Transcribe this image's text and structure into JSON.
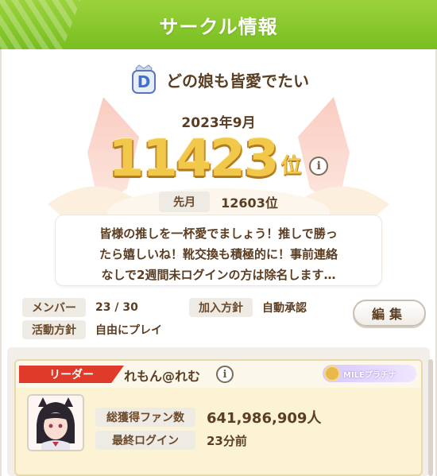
{
  "header": {
    "title": "サークル情報"
  },
  "circle": {
    "rank_badge_icon": "d-rank-crown-badge-icon",
    "rank_badge_letter": "D",
    "name": "どの娘も皆愛でたい",
    "month": "2023年9月",
    "rank_number": "11423",
    "rank_suffix": "位",
    "prev_label": "先月",
    "prev_value": "12603位",
    "description_lines": [
      "皆様の推しを一杯愛でましょう！推しで勝っ",
      "たら嬉しいね！靴交換も積極的に！事前連絡",
      "なしで2週間未ログインの方は除名します…"
    ]
  },
  "meta": {
    "members_label": "メンバー",
    "members_value": "23 / 30",
    "join_label": "加入方針",
    "join_value": "自動承認",
    "activity_label": "活動方針",
    "activity_value": "自由にプレイ"
  },
  "edit_button": "編集",
  "leader": {
    "tag": "リーダー",
    "name": "れもん@れむ",
    "rank_chip": "MILEプラチナ",
    "fans_label": "総獲得ファン数",
    "fans_value": "641,986,909人",
    "login_label": "最終ログイン",
    "login_value": "23分前"
  },
  "colors": {
    "header": "#78be20",
    "gold": "#f2c84a",
    "leader_tag": "#e03a2a",
    "leader_bg": "#fbf3d4"
  }
}
